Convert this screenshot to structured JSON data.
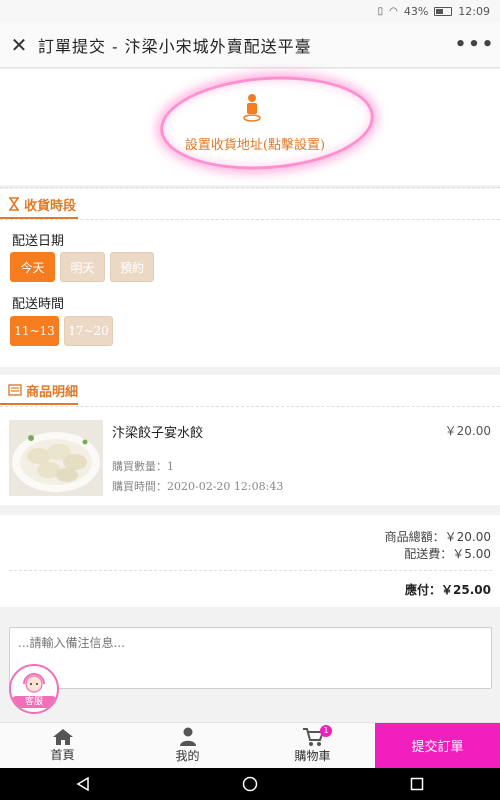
{
  "status_bar": {
    "battery": "43%",
    "time": "12:09"
  },
  "header": {
    "close_icon": "close-icon",
    "title": "訂單提交 - 汴梁小宋城外賣配送平臺",
    "more_label": "•••"
  },
  "address": {
    "label": "設置收貨地址(點擊設置)",
    "icon": "person-pin-icon"
  },
  "delivery_section": {
    "title": "收貨時段",
    "date_label": "配送日期",
    "dates": [
      {
        "label": "今天",
        "active": true
      },
      {
        "label": "明天",
        "active": false
      },
      {
        "label": "預約",
        "active": false
      }
    ],
    "time_label": "配送時間",
    "times": [
      {
        "label": "11~13",
        "active": true
      },
      {
        "label": "17~20",
        "active": false
      }
    ]
  },
  "goods_section": {
    "title": "商品明細",
    "item": {
      "name": "汴梁餃子宴水餃",
      "price": "￥20.00",
      "quantity_text": "購買數量：1",
      "time_text": "購買時間：2020-02-20 12:08:43"
    }
  },
  "summary": {
    "goods_total_label": "商品總額：",
    "goods_total_value": "￥20.00",
    "delivery_fee_label": "配送費：",
    "delivery_fee_value": "￥5.00",
    "payable_label": "應付：",
    "payable_value": "￥25.00"
  },
  "remark": {
    "placeholder": "...請輸入備注信息..."
  },
  "customer_service": {
    "label": "客服"
  },
  "tabbar": {
    "home": "首頁",
    "mine": "我的",
    "cart": "購物車",
    "cart_badge": "1",
    "submit": "提交訂單"
  },
  "colors": {
    "accent": "#f57d1f",
    "submit": "#f21fbf",
    "highlight": "#ff8fd0"
  }
}
